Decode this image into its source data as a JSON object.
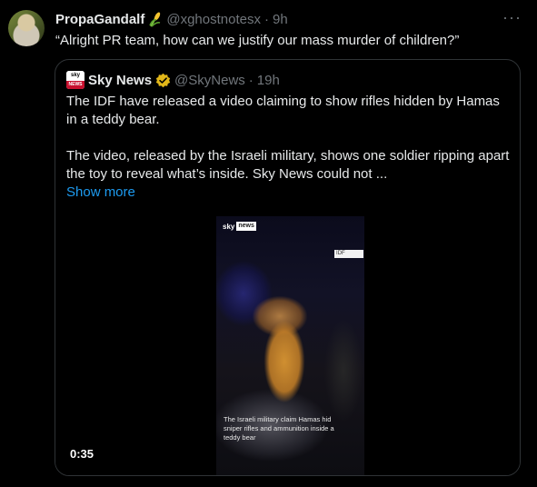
{
  "author": {
    "name": "PropaGandalf",
    "emoji_icon": "corn-icon",
    "handle": "@xghostnotesx",
    "separator": "·",
    "time": "9h",
    "more_label": "···"
  },
  "tweet_text": "“Alright PR team, how can we justify our mass murder of children?”",
  "quoted": {
    "logo_top": "sky",
    "logo_bottom": "NEWS",
    "name": "Sky News",
    "verified_icon": "verified-gold-badge-icon",
    "handle": "@SkyNews",
    "separator": "·",
    "time": "19h",
    "paragraph1": "The IDF have released a video claiming to show rifles hidden by Hamas in a teddy bear.",
    "paragraph2": "The video, released by the Israeli military, shows one soldier ripping apart the toy to reveal what’s inside. Sky News could not ...",
    "show_more": "Show more",
    "video": {
      "logo_sky": "sky",
      "logo_news": "news",
      "watermark": "IDF",
      "caption": "The Israeli military claim Hamas hid sniper rifles and ammunition inside a teddy bear",
      "duration": "0:35"
    }
  },
  "colors": {
    "background": "#000000",
    "text": "#e7e9ea",
    "muted": "#71767b",
    "link": "#1d9bf0",
    "border": "#2f3336",
    "verified_gold": "#e2b719",
    "sky_red": "#c8102e"
  }
}
